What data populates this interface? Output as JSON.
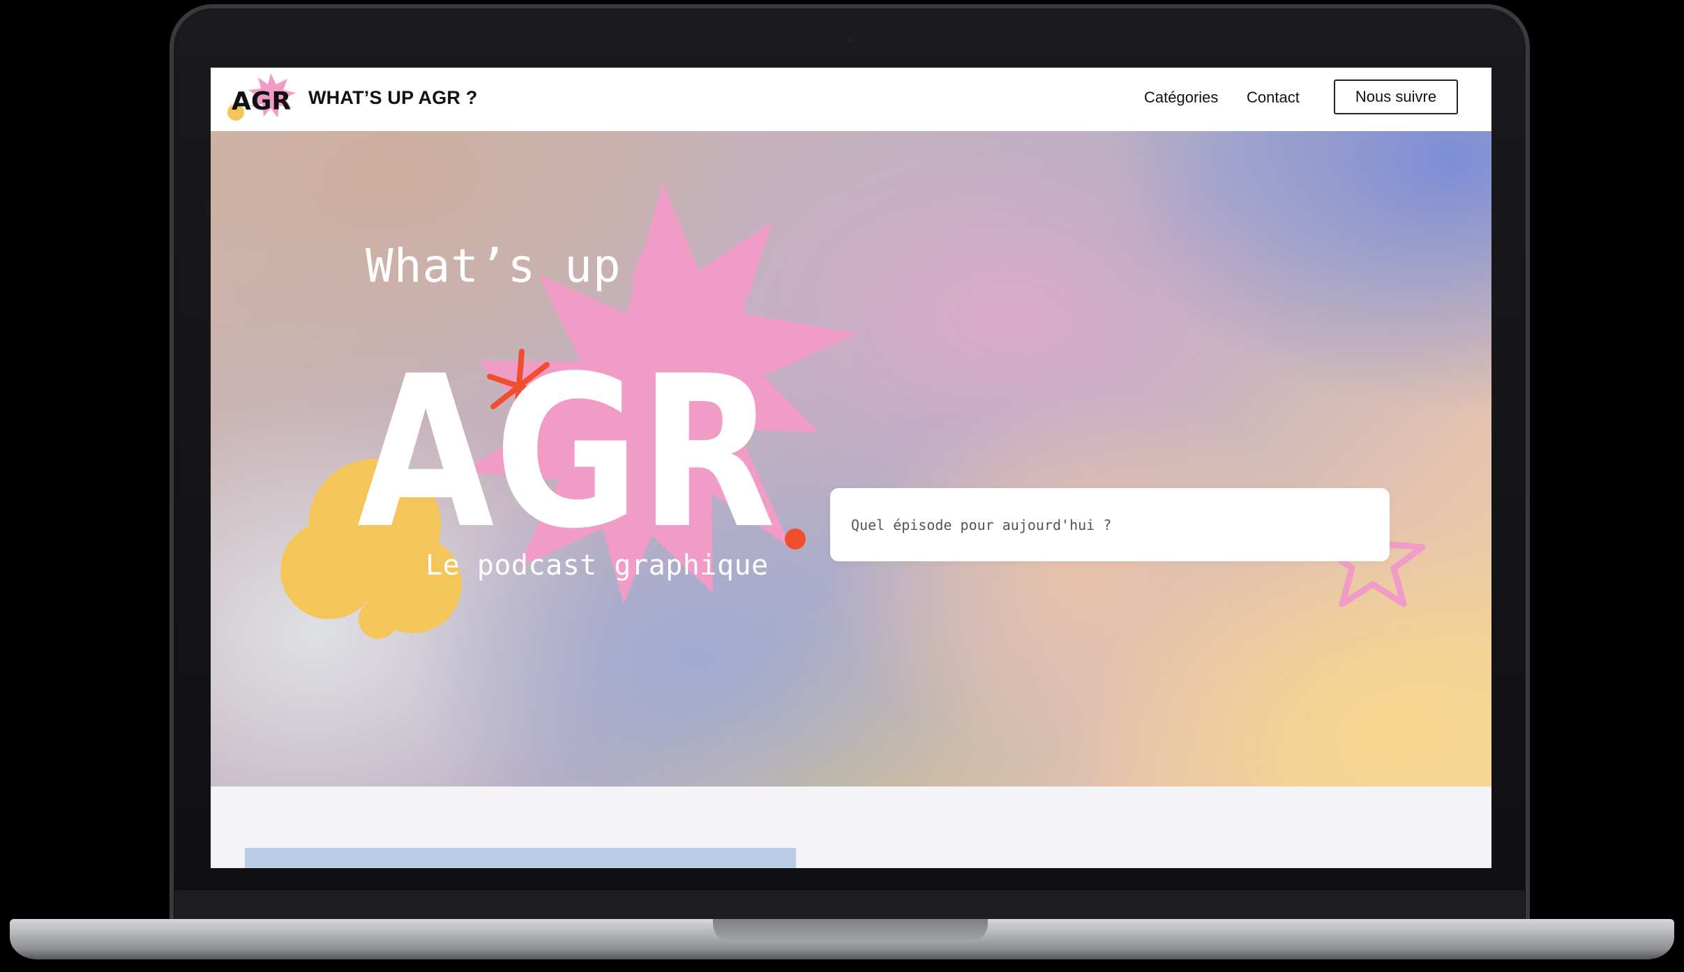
{
  "header": {
    "brand_logo_text": "AGR",
    "brand_name": "WHAT’S UP AGR ?",
    "nav": [
      {
        "label": "Catégories"
      },
      {
        "label": "Contact"
      }
    ],
    "follow_button": "Nous suivre"
  },
  "hero": {
    "kicker": "What’s up",
    "logo_text": "AGR",
    "tagline": "Le podcast graphique",
    "search": {
      "placeholder": "Quel épisode pour aujourd'hui ?",
      "value": ""
    }
  },
  "colors": {
    "pink": "#f19cc7",
    "yellow": "#f4c65a",
    "orange_red": "#ef4f2c",
    "white": "#ffffff",
    "nav_text": "#111111"
  }
}
